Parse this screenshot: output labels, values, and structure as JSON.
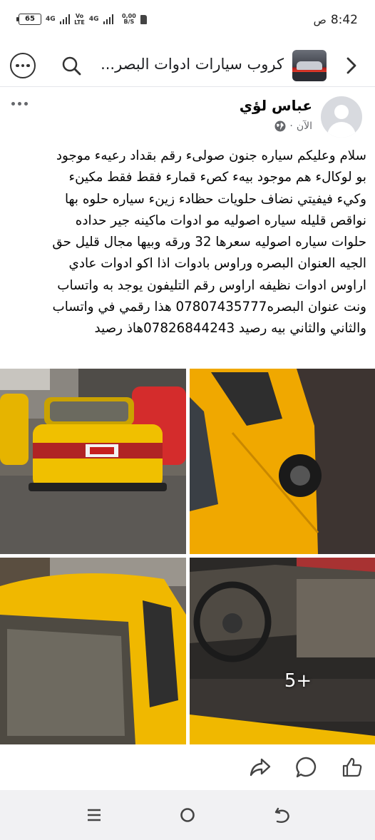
{
  "status_bar": {
    "battery": "65",
    "net1": "4G",
    "volte_top": "Vo",
    "volte_bottom": "LTE",
    "net2": "4G",
    "speed_value": "0,00",
    "speed_unit": "B/S",
    "time": "8:42",
    "ampm": "ص"
  },
  "header": {
    "group_title": "كروب سيارات ادوات البصر...",
    "icons": [
      "back-chevron-icon",
      "search-icon",
      "more-options-icon"
    ]
  },
  "post": {
    "author": "عباس لؤي",
    "timestamp": "الآن",
    "separator": "·",
    "privacy_icon": "globe-icon",
    "lines": [
      "سلام وعليكم سياره جنون صولىء رقم بقداد رعيهء موجود",
      "بو لوكالء هم موجود بيهء كصء قمارء فقط فقط مكينء",
      "وكيء فيفيتي نضاف حلويات  حظادء زينء سياره حلوه بها",
      "نواقص قليله سياره اصوليه مو ادوات ماكينه جير حداده",
      "حلوات سياره اصوليه سعرها 32 ورقه وبيها مجال قليل حق",
      "الجيه العنوان البصره وراوس بادوات اذا اكو ادوات عادي",
      "اراوس ادوات نظيفه اراوس رقم التليفون يوجد به واتساب",
      "ونت عنوان البصره07807435777 هذا رقمي في واتساب",
      "والثاني والثاني بيه رصيد 07826844243هاذ رصيد"
    ],
    "photos_more": "5+",
    "actions": [
      "share-icon",
      "comment-icon",
      "like-icon"
    ]
  },
  "nav": {
    "buttons": [
      "recents-icon",
      "home-icon",
      "back-icon"
    ]
  }
}
